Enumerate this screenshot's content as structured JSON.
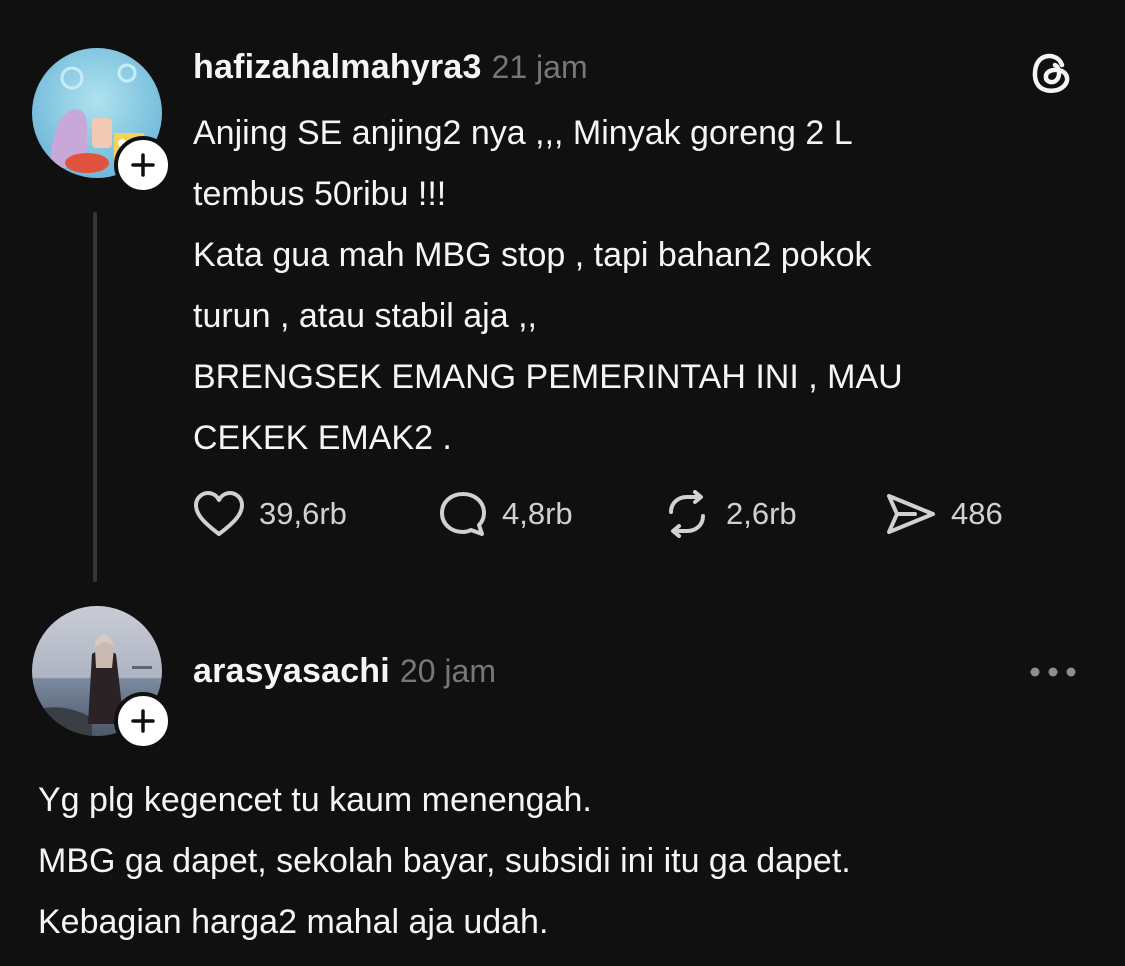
{
  "post": {
    "username": "hafizahalmahyra3",
    "time": "21 jam",
    "lines": [
      "Anjing SE anjing2 nya ,,, Minyak goreng 2 L",
      "tembus 50ribu !!!",
      "Kata gua mah MBG stop , tapi bahan2 pokok",
      "turun , atau stabil aja ,,",
      "BRENGSEK EMANG PEMERINTAH INI , MAU",
      "CEKEK EMAK2 ."
    ],
    "actions": {
      "likes": "39,6rb",
      "replies": "4,8rb",
      "reposts": "2,6rb",
      "shares": "486"
    }
  },
  "reply": {
    "username": "arasyasachi",
    "time": "20 jam",
    "lines": [
      "Yg plg kegencet tu kaum menengah.",
      "MBG ga dapet, sekolah bayar, subsidi ini itu ga dapet.",
      "Kebagian harga2 mahal aja udah."
    ]
  },
  "icons": {
    "app_logo": "threads-logo-icon",
    "like": "heart-icon",
    "reply": "comment-bubble-icon",
    "repost": "repost-icon",
    "share": "send-icon",
    "more": "more-options-icon",
    "follow": "plus-icon"
  },
  "colors": {
    "background": "#101010",
    "text": "#f3f5f7",
    "secondary_text": "#777777",
    "thread_line": "#333638"
  }
}
